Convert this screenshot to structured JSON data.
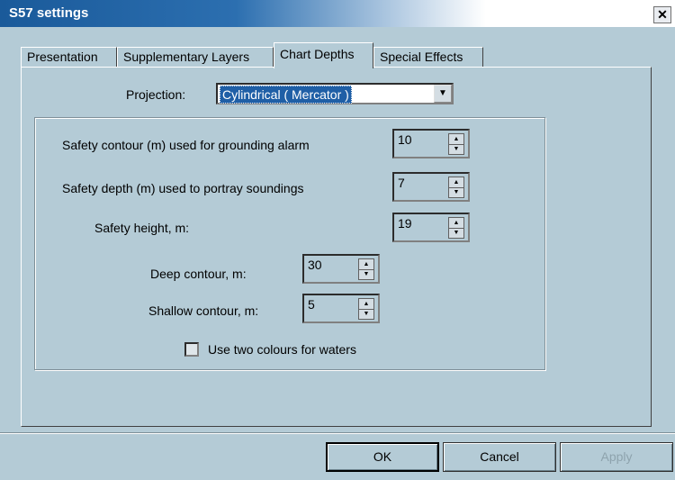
{
  "window": {
    "title": "S57 settings",
    "close_glyph": "✕"
  },
  "tabs": [
    {
      "label": "Presentation"
    },
    {
      "label": "Supplementary Layers"
    },
    {
      "label": "Chart Depths",
      "active": true
    },
    {
      "label": "Special Effects"
    }
  ],
  "projection": {
    "label": "Projection:",
    "selected": "Cylindrical ( Mercator )"
  },
  "fields": {
    "safety_contour": {
      "label": "Safety contour (m) used for grounding alarm",
      "value": "10"
    },
    "safety_depth": {
      "label": "Safety depth (m) used to portray soundings",
      "value": "7"
    },
    "safety_height": {
      "label": "Safety  height,  m:",
      "value": "19"
    },
    "deep_contour": {
      "label": "Deep contour, m:",
      "value": "30"
    },
    "shallow_contour": {
      "label": "Shallow contour, m:",
      "value": "5"
    }
  },
  "two_colours": {
    "label": "Use two colours for waters",
    "checked": false
  },
  "buttons": {
    "ok": "OK",
    "cancel": "Cancel",
    "apply": "Apply"
  },
  "colors": {
    "background": "#b4cbd6",
    "title_bar": "#2c6fb0",
    "selection": "#1f5fa6"
  }
}
